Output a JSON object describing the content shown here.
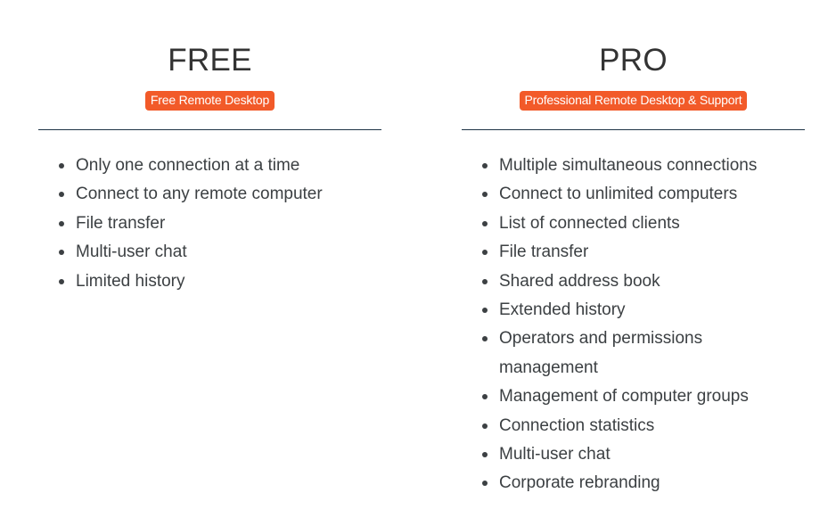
{
  "plans": [
    {
      "title": "FREE",
      "badge": "Free Remote Desktop",
      "features": [
        "Only one connection at a time",
        "Connect to any remote computer",
        "File transfer",
        "Multi-user chat",
        "Limited history"
      ]
    },
    {
      "title": "PRO",
      "badge": "Professional Remote Desktop & Support",
      "features": [
        "Multiple simultaneous connections",
        "Connect to unlimited computers",
        "List of connected clients",
        "File transfer",
        "Shared address book",
        "Extended history",
        "Operators and permissions management",
        "Management of computer groups",
        "Connection statistics",
        "Multi-user chat",
        "Corporate rebranding"
      ]
    }
  ],
  "colors": {
    "badge_bg": "#f25a29",
    "rule": "#1d3346",
    "text": "#3c4043"
  }
}
